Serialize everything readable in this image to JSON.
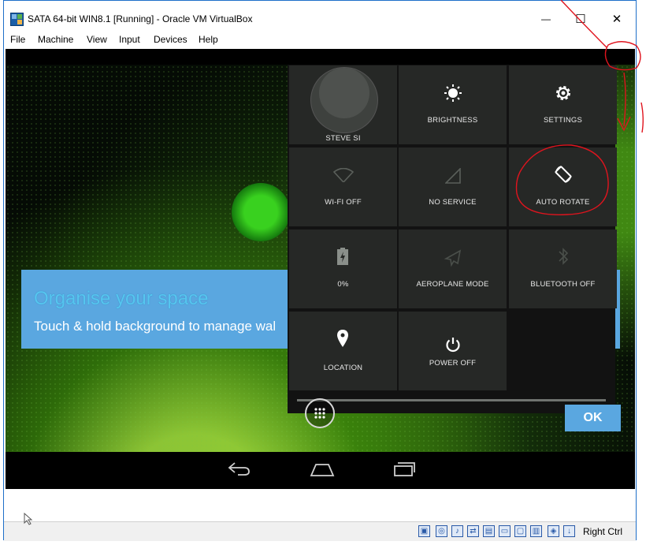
{
  "window": {
    "title": "SATA 64-bit WIN8.1 [Running] - Oracle VM VirtualBox",
    "minimize_glyph": "—",
    "maximize_glyph": "☐",
    "close_glyph": "✕"
  },
  "menu": [
    "File",
    "Machine",
    "View",
    "Input",
    "Devices",
    "Help"
  ],
  "hint": {
    "title": "Organise your space",
    "subtitle": "Touch & hold background to manage wal"
  },
  "quick_settings": {
    "user": "STEVE SI",
    "brightness": "BRIGHTNESS",
    "settings": "SETTINGS",
    "wifi": "WI-FI OFF",
    "signal": "NO SERVICE",
    "rotate": "AUTO ROTATE",
    "battery": "0%",
    "aeroplane": "AEROPLANE MODE",
    "bluetooth": "BLUETOOTH OFF",
    "location": "LOCATION",
    "power": "POWER OFF"
  },
  "ok_label": "OK",
  "status_bar": {
    "host_key": "Right Ctrl"
  },
  "annotation_color": "#e0141e",
  "icons": {
    "brightness": "brightness-icon",
    "settings": "gear-icon",
    "wifi": "wifi-icon",
    "signal": "signal-icon",
    "rotate": "rotate-icon",
    "battery": "battery-icon",
    "aeroplane": "aeroplane-icon",
    "bluetooth": "bluetooth-icon",
    "location": "location-icon",
    "power": "power-icon",
    "apps": "apps-grid-icon",
    "back": "back-icon",
    "home": "home-icon",
    "recents": "recents-icon"
  }
}
